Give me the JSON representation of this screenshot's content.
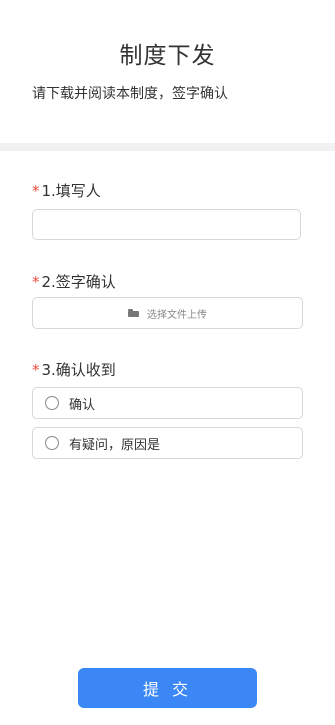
{
  "header": {
    "title": "制度下发",
    "subtitle": "请下载并阅读本制度，签字确认"
  },
  "questions": [
    {
      "required_mark": "*",
      "label": "1.填写人",
      "type": "text",
      "value": ""
    },
    {
      "required_mark": "*",
      "label": "2.签字确认",
      "type": "upload",
      "upload_text": "选择文件上传",
      "icon": "folder-icon"
    },
    {
      "required_mark": "*",
      "label": "3.确认收到",
      "type": "radio",
      "options": [
        "确认",
        "有疑问，原因是"
      ]
    }
  ],
  "submit_label": "提 交",
  "colors": {
    "accent": "#3b87f5",
    "required": "#e84c3d"
  }
}
